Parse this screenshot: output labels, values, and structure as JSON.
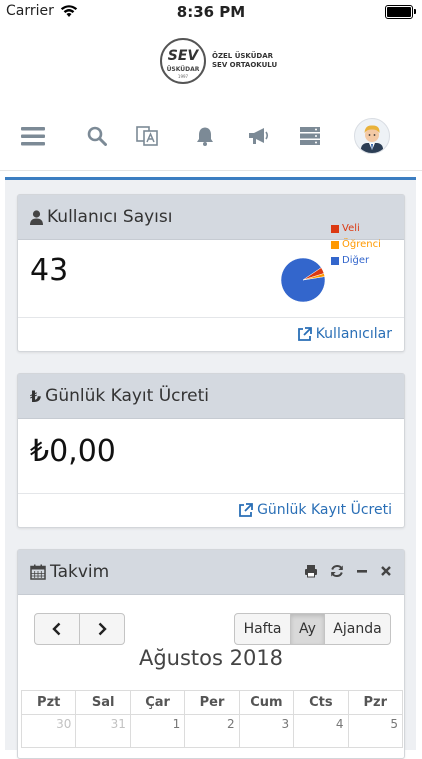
{
  "status": {
    "carrier": "Carrier",
    "time": "8:36 PM"
  },
  "logo": {
    "mark": "SEV",
    "sub": "ÜSKÜDAR",
    "year": "1997",
    "line1": "ÖZEL ÜSKÜDAR",
    "line2": "SEV ORTAOKULU"
  },
  "toolbar": {
    "icons": [
      "menu-icon",
      "search-icon",
      "translate-icon",
      "bell-icon",
      "megaphone-icon",
      "list-icon",
      "avatar"
    ]
  },
  "users_panel": {
    "title": "Kullanıcı Sayısı",
    "count": "43",
    "link": "Kullanıcılar",
    "chart_data": {
      "type": "pie",
      "categories": [
        "Veli",
        "Öğrenci",
        "Diğer"
      ],
      "values": [
        2,
        1,
        40
      ],
      "colors": [
        "#dc3912",
        "#ff9900",
        "#3366cc"
      ]
    }
  },
  "fee_panel": {
    "title": "Günlük Kayıt Ücreti",
    "amount": "₺0,00",
    "link": "Günlük Kayıt Ücreti"
  },
  "calendar": {
    "title": "Takvim",
    "month": "Ağustos 2018",
    "views": [
      "Hafta",
      "Ay",
      "Ajanda"
    ],
    "active_view": "Ay",
    "days": [
      "Pzt",
      "Sal",
      "Çar",
      "Per",
      "Cum",
      "Cts",
      "Pzr"
    ],
    "first_row": [
      "30",
      "31",
      "1",
      "2",
      "3",
      "4",
      "5"
    ],
    "prev": "‹",
    "next": "›"
  },
  "accent": "#3c7ec1"
}
